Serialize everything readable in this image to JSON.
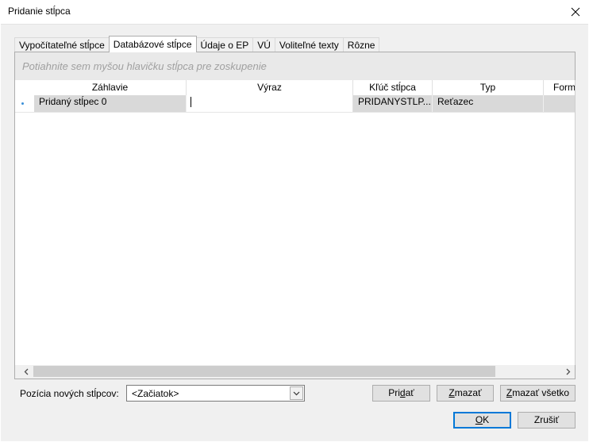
{
  "window": {
    "title": "Pridanie stĺpca"
  },
  "tabs": [
    {
      "label": "Vypočítateľné stĺpce",
      "active": false
    },
    {
      "label": "Databázové stĺpce",
      "active": true
    },
    {
      "label": "Údaje o EP",
      "active": false
    },
    {
      "label": "VÚ",
      "active": false
    },
    {
      "label": "Voliteľné texty",
      "active": false
    },
    {
      "label": "Rôzne",
      "active": false
    }
  ],
  "grid": {
    "group_hint": "Potiahnite sem myšou hlavičku stĺpca pre zoskupenie",
    "columns": [
      "Záhlavie",
      "Výraz",
      "Kľúč stĺpca",
      "Typ",
      "Form"
    ],
    "rows": [
      {
        "zahlavie": "Pridaný stĺpec 0",
        "vyraz": "",
        "kluc": "PRIDANYSTLP...",
        "typ": "Reťazec",
        "format": ""
      }
    ]
  },
  "position": {
    "label": "Pozícia nových stĺpcov:",
    "value": "<Začiatok>"
  },
  "buttons": {
    "add": {
      "pre": "Pri",
      "key": "d",
      "post": "ať"
    },
    "delete": {
      "pre": "",
      "key": "Z",
      "post": "mazať"
    },
    "delete_all": {
      "pre": "",
      "key": "Z",
      "post": "mazať všetko"
    },
    "ok": {
      "pre": "",
      "key": "O",
      "post": "K"
    },
    "cancel": {
      "pre": "Zrušiť",
      "key": "",
      "post": ""
    }
  },
  "colors": {
    "accent": "#0078d7",
    "selected_row": "#d9d9d9",
    "row_indicator": "#3a8fd8"
  }
}
